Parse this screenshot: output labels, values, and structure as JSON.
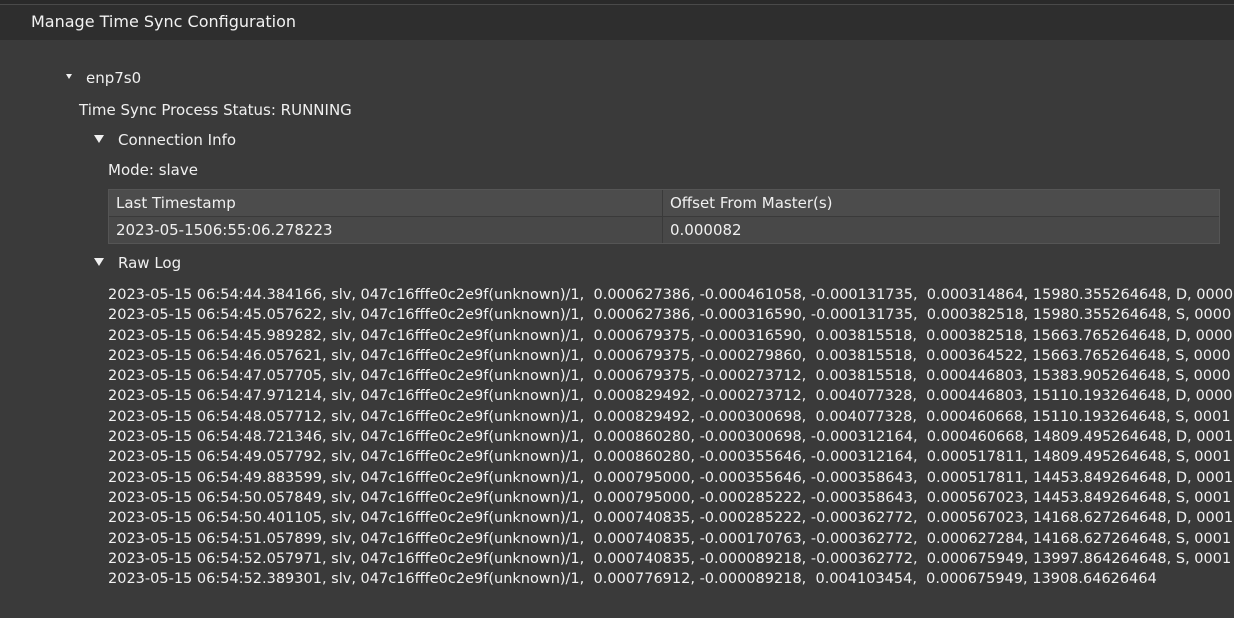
{
  "title": "Manage Time Sync Configuration",
  "interface": {
    "name": "enp7s0",
    "status_text": "Time Sync Process Status: RUNNING",
    "connection_info": {
      "label": "Connection Info",
      "mode_text": "Mode: slave",
      "table": {
        "columns": [
          "Last Timestamp",
          "Offset From Master(s)"
        ],
        "rows": [
          [
            "2023-05-1506:55:06.278223",
            "0.000082"
          ]
        ]
      }
    },
    "raw_log": {
      "label": "Raw Log",
      "lines": [
        "2023-05-15 06:54:44.384166, slv, 047c16fffe0c2e9f(unknown)/1,  0.000627386, -0.000461058, -0.000131735,  0.000314864, 15980.355264648, D, 0000",
        "2023-05-15 06:54:45.057622, slv, 047c16fffe0c2e9f(unknown)/1,  0.000627386, -0.000316590, -0.000131735,  0.000382518, 15980.355264648, S, 0000",
        "2023-05-15 06:54:45.989282, slv, 047c16fffe0c2e9f(unknown)/1,  0.000679375, -0.000316590,  0.003815518,  0.000382518, 15663.765264648, D, 0000",
        "2023-05-15 06:54:46.057621, slv, 047c16fffe0c2e9f(unknown)/1,  0.000679375, -0.000279860,  0.003815518,  0.000364522, 15663.765264648, S, 0000",
        "2023-05-15 06:54:47.057705, slv, 047c16fffe0c2e9f(unknown)/1,  0.000679375, -0.000273712,  0.003815518,  0.000446803, 15383.905264648, S, 0000",
        "2023-05-15 06:54:47.971214, slv, 047c16fffe0c2e9f(unknown)/1,  0.000829492, -0.000273712,  0.004077328,  0.000446803, 15110.193264648, D, 0000",
        "2023-05-15 06:54:48.057712, slv, 047c16fffe0c2e9f(unknown)/1,  0.000829492, -0.000300698,  0.004077328,  0.000460668, 15110.193264648, S, 0001",
        "2023-05-15 06:54:48.721346, slv, 047c16fffe0c2e9f(unknown)/1,  0.000860280, -0.000300698, -0.000312164,  0.000460668, 14809.495264648, D, 0001",
        "2023-05-15 06:54:49.057792, slv, 047c16fffe0c2e9f(unknown)/1,  0.000860280, -0.000355646, -0.000312164,  0.000517811, 14809.495264648, S, 0001",
        "2023-05-15 06:54:49.883599, slv, 047c16fffe0c2e9f(unknown)/1,  0.000795000, -0.000355646, -0.000358643,  0.000517811, 14453.849264648, D, 0001",
        "2023-05-15 06:54:50.057849, slv, 047c16fffe0c2e9f(unknown)/1,  0.000795000, -0.000285222, -0.000358643,  0.000567023, 14453.849264648, S, 0001",
        "2023-05-15 06:54:50.401105, slv, 047c16fffe0c2e9f(unknown)/1,  0.000740835, -0.000285222, -0.000362772,  0.000567023, 14168.627264648, D, 0001",
        "2023-05-15 06:54:51.057899, slv, 047c16fffe0c2e9f(unknown)/1,  0.000740835, -0.000170763, -0.000362772,  0.000627284, 14168.627264648, S, 0001",
        "2023-05-15 06:54:52.057971, slv, 047c16fffe0c2e9f(unknown)/1,  0.000740835, -0.000089218, -0.000362772,  0.000675949, 13997.864264648, S, 0001",
        "2023-05-15 06:54:52.389301, slv, 047c16fffe0c2e9f(unknown)/1,  0.000776912, -0.000089218,  0.004103454,  0.000675949, 13908.64626464"
      ]
    }
  }
}
